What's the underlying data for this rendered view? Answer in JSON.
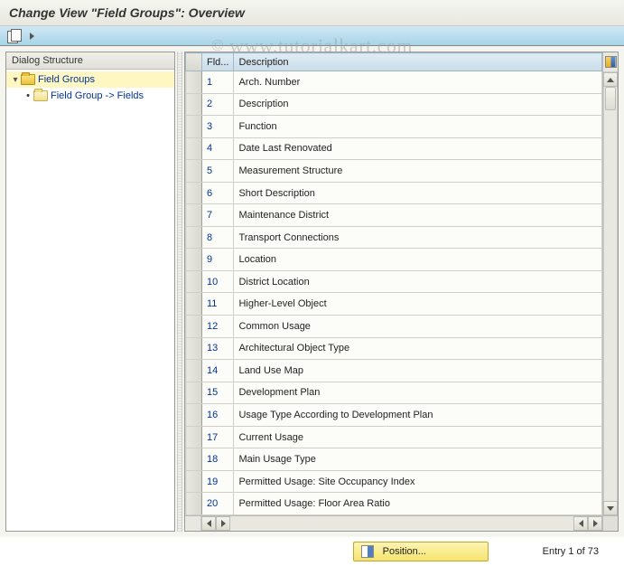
{
  "title": "Change View \"Field Groups\": Overview",
  "watermark": "www.tutorialkart.com",
  "tree": {
    "header": "Dialog Structure",
    "root_label": "Field Groups",
    "child_label": "Field Group -> Fields"
  },
  "grid": {
    "col_fld": "Fld...",
    "col_desc": "Description",
    "rows": [
      {
        "id": "1",
        "desc": "Arch. Number"
      },
      {
        "id": "2",
        "desc": "Description"
      },
      {
        "id": "3",
        "desc": "Function"
      },
      {
        "id": "4",
        "desc": "Date Last Renovated"
      },
      {
        "id": "5",
        "desc": "Measurement Structure"
      },
      {
        "id": "6",
        "desc": "Short Description"
      },
      {
        "id": "7",
        "desc": "Maintenance District"
      },
      {
        "id": "8",
        "desc": "Transport Connections"
      },
      {
        "id": "9",
        "desc": "Location"
      },
      {
        "id": "10",
        "desc": "District Location"
      },
      {
        "id": "11",
        "desc": "Higher-Level Object"
      },
      {
        "id": "12",
        "desc": "Common Usage"
      },
      {
        "id": "13",
        "desc": "Architectural Object Type"
      },
      {
        "id": "14",
        "desc": "Land Use Map"
      },
      {
        "id": "15",
        "desc": "Development Plan"
      },
      {
        "id": "16",
        "desc": "Usage Type According to Development Plan"
      },
      {
        "id": "17",
        "desc": "Current Usage"
      },
      {
        "id": "18",
        "desc": "Main Usage Type"
      },
      {
        "id": "19",
        "desc": "Permitted Usage: Site Occupancy Index"
      },
      {
        "id": "20",
        "desc": "Permitted Usage: Floor Area Ratio"
      }
    ]
  },
  "footer": {
    "position_label": "Position...",
    "entry_text": "Entry 1 of 73"
  }
}
